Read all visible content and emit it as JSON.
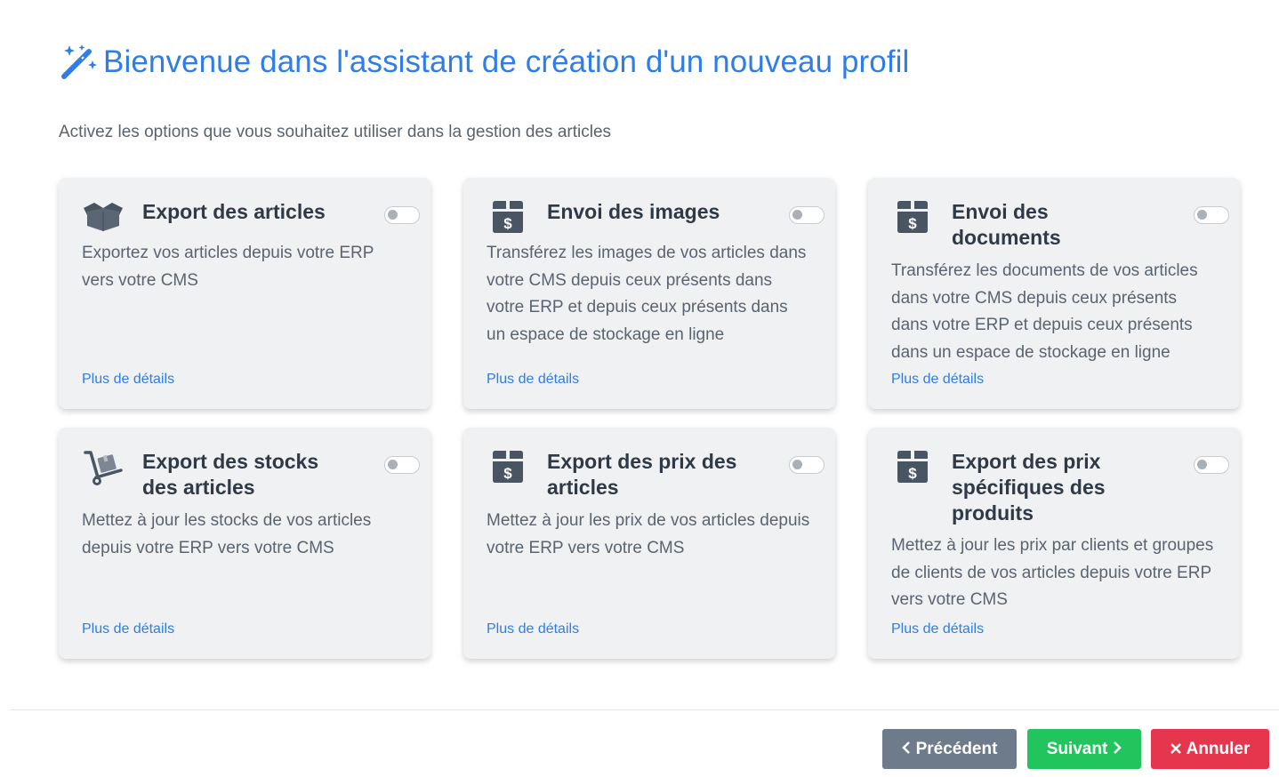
{
  "header": {
    "title": "Bienvenue dans l'assistant de création d'un nouveau profil",
    "subtitle": "Activez les options que vous souhaitez utiliser dans la gestion des articles"
  },
  "cards": [
    {
      "icon": "open-box-icon",
      "title": "Export des articles",
      "description": "Exportez vos articles depuis votre ERP vers votre CMS",
      "link": "Plus de détails",
      "enabled": false
    },
    {
      "icon": "dollar-box-icon",
      "title": "Envoi des images",
      "description": "Transférez les images de vos articles dans votre CMS depuis ceux présents dans votre ERP et depuis ceux présents dans un espace de stockage en ligne",
      "link": "Plus de détails",
      "enabled": false
    },
    {
      "icon": "dollar-box-icon",
      "title": "Envoi des documents",
      "description": "Transférez les documents de vos articles dans votre CMS depuis ceux présents dans votre ERP et depuis ceux présents dans un espace de stockage en ligne",
      "link": "Plus de détails",
      "enabled": false
    },
    {
      "icon": "hand-truck-icon",
      "title": "Export des stocks des articles",
      "description": "Mettez à jour les stocks de vos articles depuis votre ERP vers votre CMS",
      "link": "Plus de détails",
      "enabled": false
    },
    {
      "icon": "dollar-box-icon",
      "title": "Export des prix des articles",
      "description": "Mettez à jour les prix de vos articles depuis votre ERP vers votre CMS",
      "link": "Plus de détails",
      "enabled": false
    },
    {
      "icon": "dollar-box-icon",
      "title": "Export des prix spécifiques des produits",
      "description": "Mettez à jour les prix par clients et groupes de clients de vos articles depuis votre ERP vers votre CMS",
      "link": "Plus de détails",
      "enabled": false
    }
  ],
  "footer": {
    "prev_label": "Précédent",
    "next_label": "Suivant",
    "cancel_label": "Annuler"
  },
  "colors": {
    "accent": "#2f7de8",
    "card_bg": "#f0f1f3",
    "prev": "#6e7b8b",
    "next": "#22c45e",
    "cancel": "#e5364d"
  }
}
